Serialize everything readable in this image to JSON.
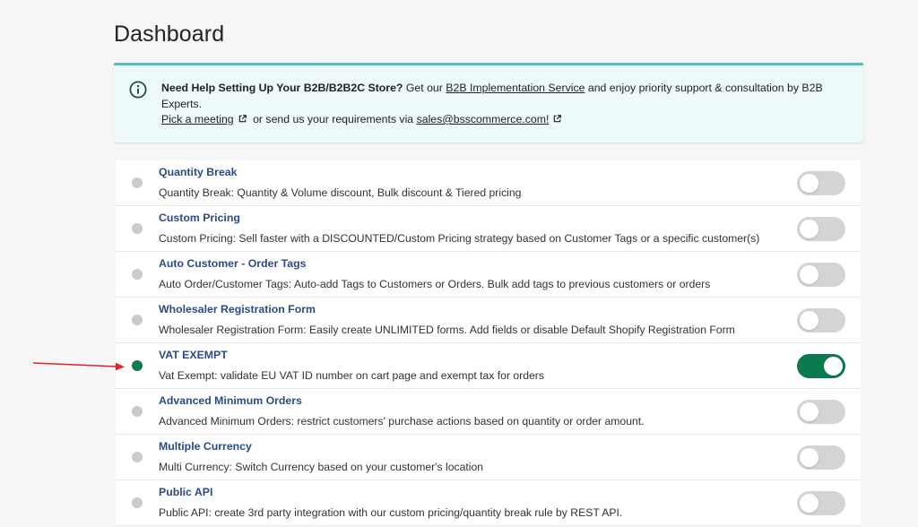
{
  "page": {
    "title": "Dashboard"
  },
  "banner": {
    "icon": "info-circle-icon",
    "bold_text": "Need Help Setting Up Your B2B/B2B2C Store?",
    "text_get_our": " Get our ",
    "implementation_link": "B2B Implementation Service",
    "text_enjoy": " and enjoy priority support & consultation by B2B Experts.",
    "meeting_link": "Pick a meeting",
    "text_send": " or send us your requirements via ",
    "email_link": "sales@bsscommerce.com!",
    "accent_color": "#50c1bd",
    "background_color": "#eef9f9"
  },
  "features": [
    {
      "title": "Quantity Break",
      "description": "Quantity Break: Quantity & Volume discount, Bulk discount & Tiered pricing",
      "enabled": false
    },
    {
      "title": "Custom Pricing",
      "description": "Custom Pricing: Sell faster with a DISCOUNTED/Custom Pricing strategy based on Customer Tags or a specific customer(s)",
      "enabled": false
    },
    {
      "title": "Auto Customer - Order Tags",
      "description": "Auto Order/Customer Tags: Auto-add Tags to Customers or Orders. Bulk add tags to previous customers or orders",
      "enabled": false
    },
    {
      "title": "Wholesaler Registration Form",
      "description": "Wholesaler Registration Form: Easily create UNLIMITED forms. Add fields or disable Default Shopify Registration Form",
      "enabled": false
    },
    {
      "title": "VAT EXEMPT",
      "description": "Vat Exempt: validate EU VAT ID number on cart page and exempt tax for orders",
      "enabled": true
    },
    {
      "title": "Advanced Minimum Orders",
      "description": "Advanced Minimum Orders: restrict customers' purchase actions based on quantity or order amount.",
      "enabled": false
    },
    {
      "title": "Multiple Currency",
      "description": "Multi Currency: Switch Currency based on your customer's location",
      "enabled": false
    },
    {
      "title": "Public API",
      "description": "Public API: create 3rd party integration with our custom pricing/quantity break rule by REST API.",
      "enabled": false
    }
  ],
  "colors": {
    "enabled": "#0b7a4f",
    "disabled": "#d2d4d6",
    "title_link": "#2c4a86",
    "annotation_arrow": "#e02424"
  },
  "annotation": {
    "icon": "red-arrow-icon"
  }
}
